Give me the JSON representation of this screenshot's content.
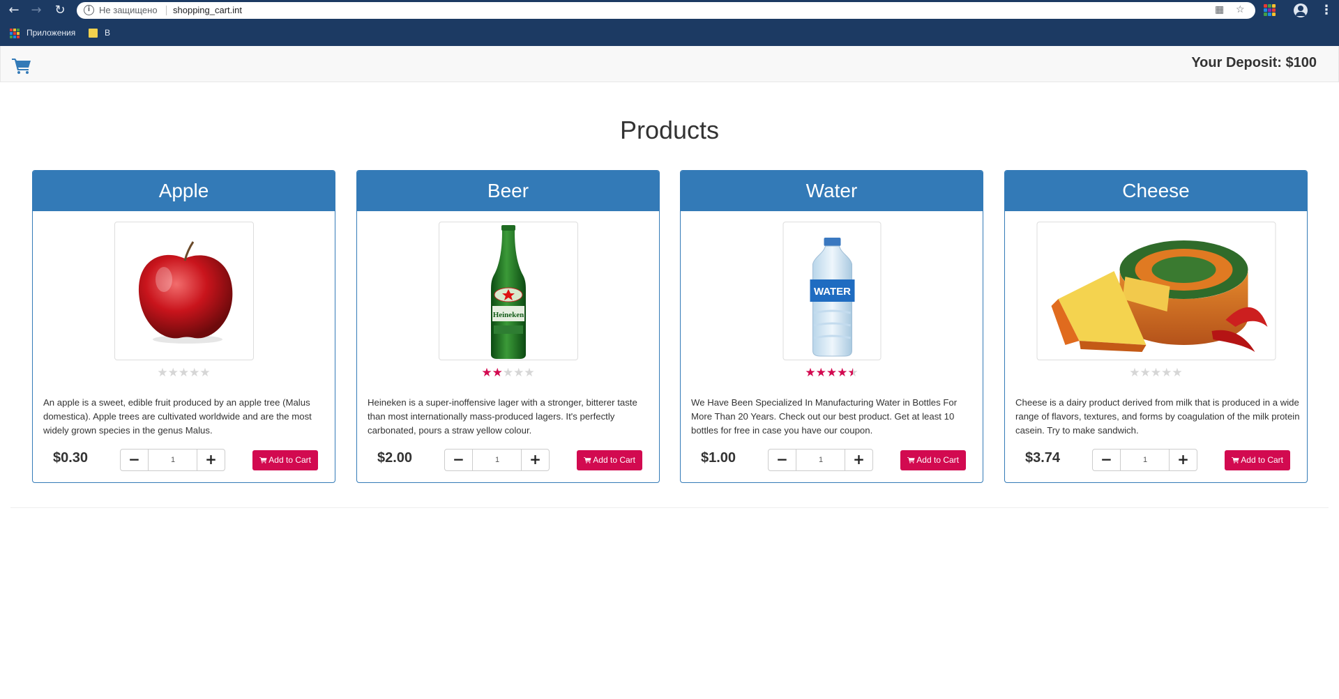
{
  "browser": {
    "security_text": "Не защищено",
    "url": "shopping_cart.int",
    "bookmarks": [
      {
        "label": "Приложения"
      },
      {
        "label": "B"
      }
    ]
  },
  "header": {
    "deposit_text": "Your Deposit: $100",
    "cart_icon": "shopping-cart-icon"
  },
  "page": {
    "title": "Products"
  },
  "colors": {
    "brand": "#337ab7",
    "accent": "#d20a50",
    "chrome": "#1c3a63"
  },
  "products": [
    {
      "name": "Apple",
      "image": "red-apple",
      "rating": 0,
      "description": "An apple is a sweet, edible fruit produced by an apple tree (Malus domestica). Apple trees are cultivated worldwide and are the most widely grown species in the genus Malus.",
      "price": "$0.30",
      "quantity": "1",
      "button_label": "Add to Cart"
    },
    {
      "name": "Beer",
      "image": "green-beer-bottle",
      "rating": 2,
      "description": "Heineken is a super-inoffensive lager with a stronger, bitterer taste than most internationally mass-produced lagers. It's perfectly carbonated, pours a straw yellow colour.",
      "price": "$2.00",
      "quantity": "1",
      "button_label": "Add to Cart"
    },
    {
      "name": "Water",
      "image": "water-bottle",
      "rating": 4.5,
      "description": "We Have Been Specialized In Manufacturing Water in Bottles For More Than 20 Years. Check out our best product. Get at least 10 bottles for free in case you have our coupon.",
      "price": "$1.00",
      "quantity": "1",
      "button_label": "Add to Cart"
    },
    {
      "name": "Cheese",
      "image": "cheese-wheel",
      "rating": 0,
      "description": "Cheese is a dairy product derived from milk that is produced in a wide range of flavors, textures, and forms by coagulation of the milk protein casein. Try to make sandwich.",
      "price": "$3.74",
      "quantity": "1",
      "button_label": "Add to Cart"
    }
  ]
}
